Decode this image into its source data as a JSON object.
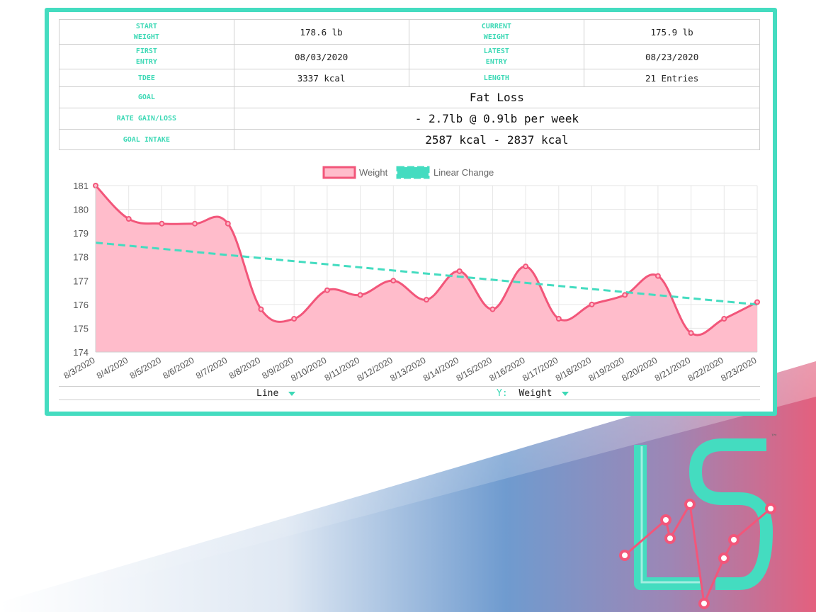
{
  "stats": {
    "start_weight_label": [
      "START",
      "WEIGHT"
    ],
    "start_weight": "178.6 lb",
    "current_weight_label": [
      "CURRENT",
      "WEIGHT"
    ],
    "current_weight": "175.9 lb",
    "first_entry_label": [
      "FIRST",
      "ENTRY"
    ],
    "first_entry": "08/03/2020",
    "latest_entry_label": [
      "LATEST",
      "ENTRY"
    ],
    "latest_entry": "08/23/2020",
    "tdee_label": "TDEE",
    "tdee": "3337 kcal",
    "length_label": "LENGTH",
    "length": "21 Entries",
    "goal_label": "GOAL",
    "goal": "Fat Loss",
    "rate_label": "RATE GAIN/LOSS",
    "rate": "- 2.7lb @ 0.9lb per week",
    "intake_label": "GOAL INTAKE",
    "intake": "2587 kcal - 2837 kcal"
  },
  "controls": {
    "chart_type": "Line",
    "y_prefix": "Y:",
    "y_value": "Weight"
  },
  "colors": {
    "accent": "#44dcc0",
    "weight_line": "#f2567a",
    "weight_fill": "#ffbccb"
  },
  "logo": {
    "text": "LS",
    "trademark": "™"
  },
  "chart_data": {
    "type": "line",
    "x": [
      "8/3/2020",
      "8/4/2020",
      "8/5/2020",
      "8/6/2020",
      "8/7/2020",
      "8/8/2020",
      "8/9/2020",
      "8/10/2020",
      "8/11/2020",
      "8/12/2020",
      "8/13/2020",
      "8/14/2020",
      "8/15/2020",
      "8/16/2020",
      "8/17/2020",
      "8/18/2020",
      "8/19/2020",
      "8/20/2020",
      "8/21/2020",
      "8/22/2020",
      "8/23/2020"
    ],
    "series": [
      {
        "name": "Weight",
        "type": "area",
        "values": [
          181.0,
          179.6,
          179.4,
          179.4,
          179.4,
          175.8,
          175.4,
          176.6,
          176.4,
          177.0,
          176.2,
          177.4,
          175.8,
          177.6,
          175.4,
          176.0,
          176.4,
          177.2,
          174.8,
          175.4,
          176.1
        ]
      },
      {
        "name": "Linear Change",
        "type": "dashed-line",
        "values": [
          178.6,
          176.0
        ]
      }
    ],
    "yticks": [
      174,
      175,
      176,
      177,
      178,
      179,
      180,
      181
    ],
    "ylim": [
      174,
      181
    ],
    "grid": true,
    "legend": "top-center",
    "title": "",
    "xlabel": "",
    "ylabel": ""
  }
}
